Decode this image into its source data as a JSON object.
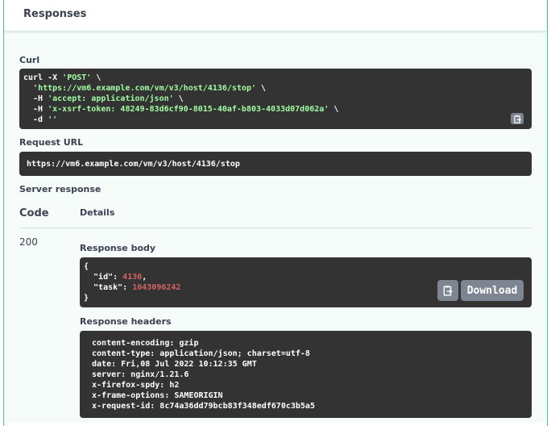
{
  "responses": {
    "title": "Responses"
  },
  "curl": {
    "label": "Curl",
    "line1_prefix": "curl -X ",
    "method": "'POST'",
    "line1_suffix": " \\",
    "url": "'https://vm6.example.com/vm/v3/host/4136/stop'",
    "url_suffix": " \\",
    "h1_prefix": "  -H ",
    "h1": "'accept: application/json'",
    "h1_suffix": " \\",
    "h2_prefix": "  -H ",
    "h2": "'x-xsrf-token: 48249-83d6cf90-8015-40af-b803-4033d07d062a'",
    "h2_suffix": " \\",
    "d_prefix": "  -d ",
    "d": "''"
  },
  "request_url": {
    "label": "Request URL",
    "value": "https://vm6.example.com/vm/v3/host/4136/stop"
  },
  "server_response": {
    "label": "Server response",
    "col_code": "Code",
    "col_details": "Details",
    "code": "200",
    "body_label": "Response body",
    "body": {
      "open": "{",
      "id_key": "  \"id\": ",
      "id_val": "4136",
      "id_comma": ",",
      "task_key": "  \"task\": ",
      "task_val": "1043096242",
      "close": "}"
    },
    "download_label": "Download",
    "headers_label": "Response headers",
    "headers": [
      " content-encoding: gzip",
      " content-type: application/json; charset=utf-8",
      " date: Fri,08 Jul 2022 10:12:35 GMT",
      " server: nginx/1.21.6",
      " x-firefox-spdy: h2",
      " x-frame-options: SAMEORIGIN",
      " x-request-id: 8c74a36dd79bcb83f348edf670c3b5a5"
    ]
  },
  "colors": {
    "accent": "#49cc90",
    "code_bg": "#333333",
    "string": "#a2fca2",
    "number": "#d36363",
    "button": "#7d8492"
  },
  "icons": {
    "copy": "copy-to-clipboard-icon"
  }
}
